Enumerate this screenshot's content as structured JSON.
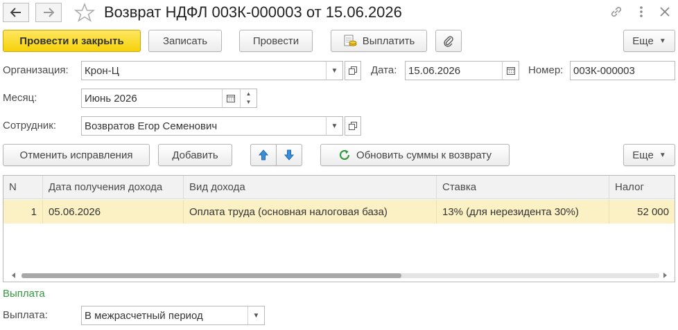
{
  "window": {
    "title": "Возврат НДФЛ 003К-000003 от 15.06.2026"
  },
  "toolbar": {
    "post_close": "Провести и закрыть",
    "save": "Записать",
    "post": "Провести",
    "pay": "Выплатить",
    "more": "Еще"
  },
  "form": {
    "org_label": "Организация:",
    "org_value": "Крон-Ц",
    "date_label": "Дата:",
    "date_value": "15.06.2026",
    "number_label": "Номер:",
    "number_value": "003К-000003",
    "month_label": "Месяц:",
    "month_value": "Июнь 2026",
    "employee_label": "Сотрудник:",
    "employee_value": "Возвратов Егор Семенович"
  },
  "table_toolbar": {
    "cancel_corrections": "Отменить исправления",
    "add": "Добавить",
    "refresh": "Обновить суммы к возврату",
    "more": "Еще"
  },
  "table": {
    "columns": [
      "N",
      "Дата получения дохода",
      "Вид дохода",
      "Ставка",
      "Налог"
    ],
    "rows": [
      [
        "1",
        "05.06.2026",
        "Оплата труда (основная налоговая база)",
        "13% (для нерезидента 30%)",
        "52 000"
      ]
    ]
  },
  "payment": {
    "section_title": "Выплата",
    "label": "Выплата:",
    "value": "В межрасчетный период"
  },
  "colors": {
    "primary_button": "#f5d20a",
    "selected_row": "#fbf1c4",
    "section_title": "#2f9a3a"
  }
}
